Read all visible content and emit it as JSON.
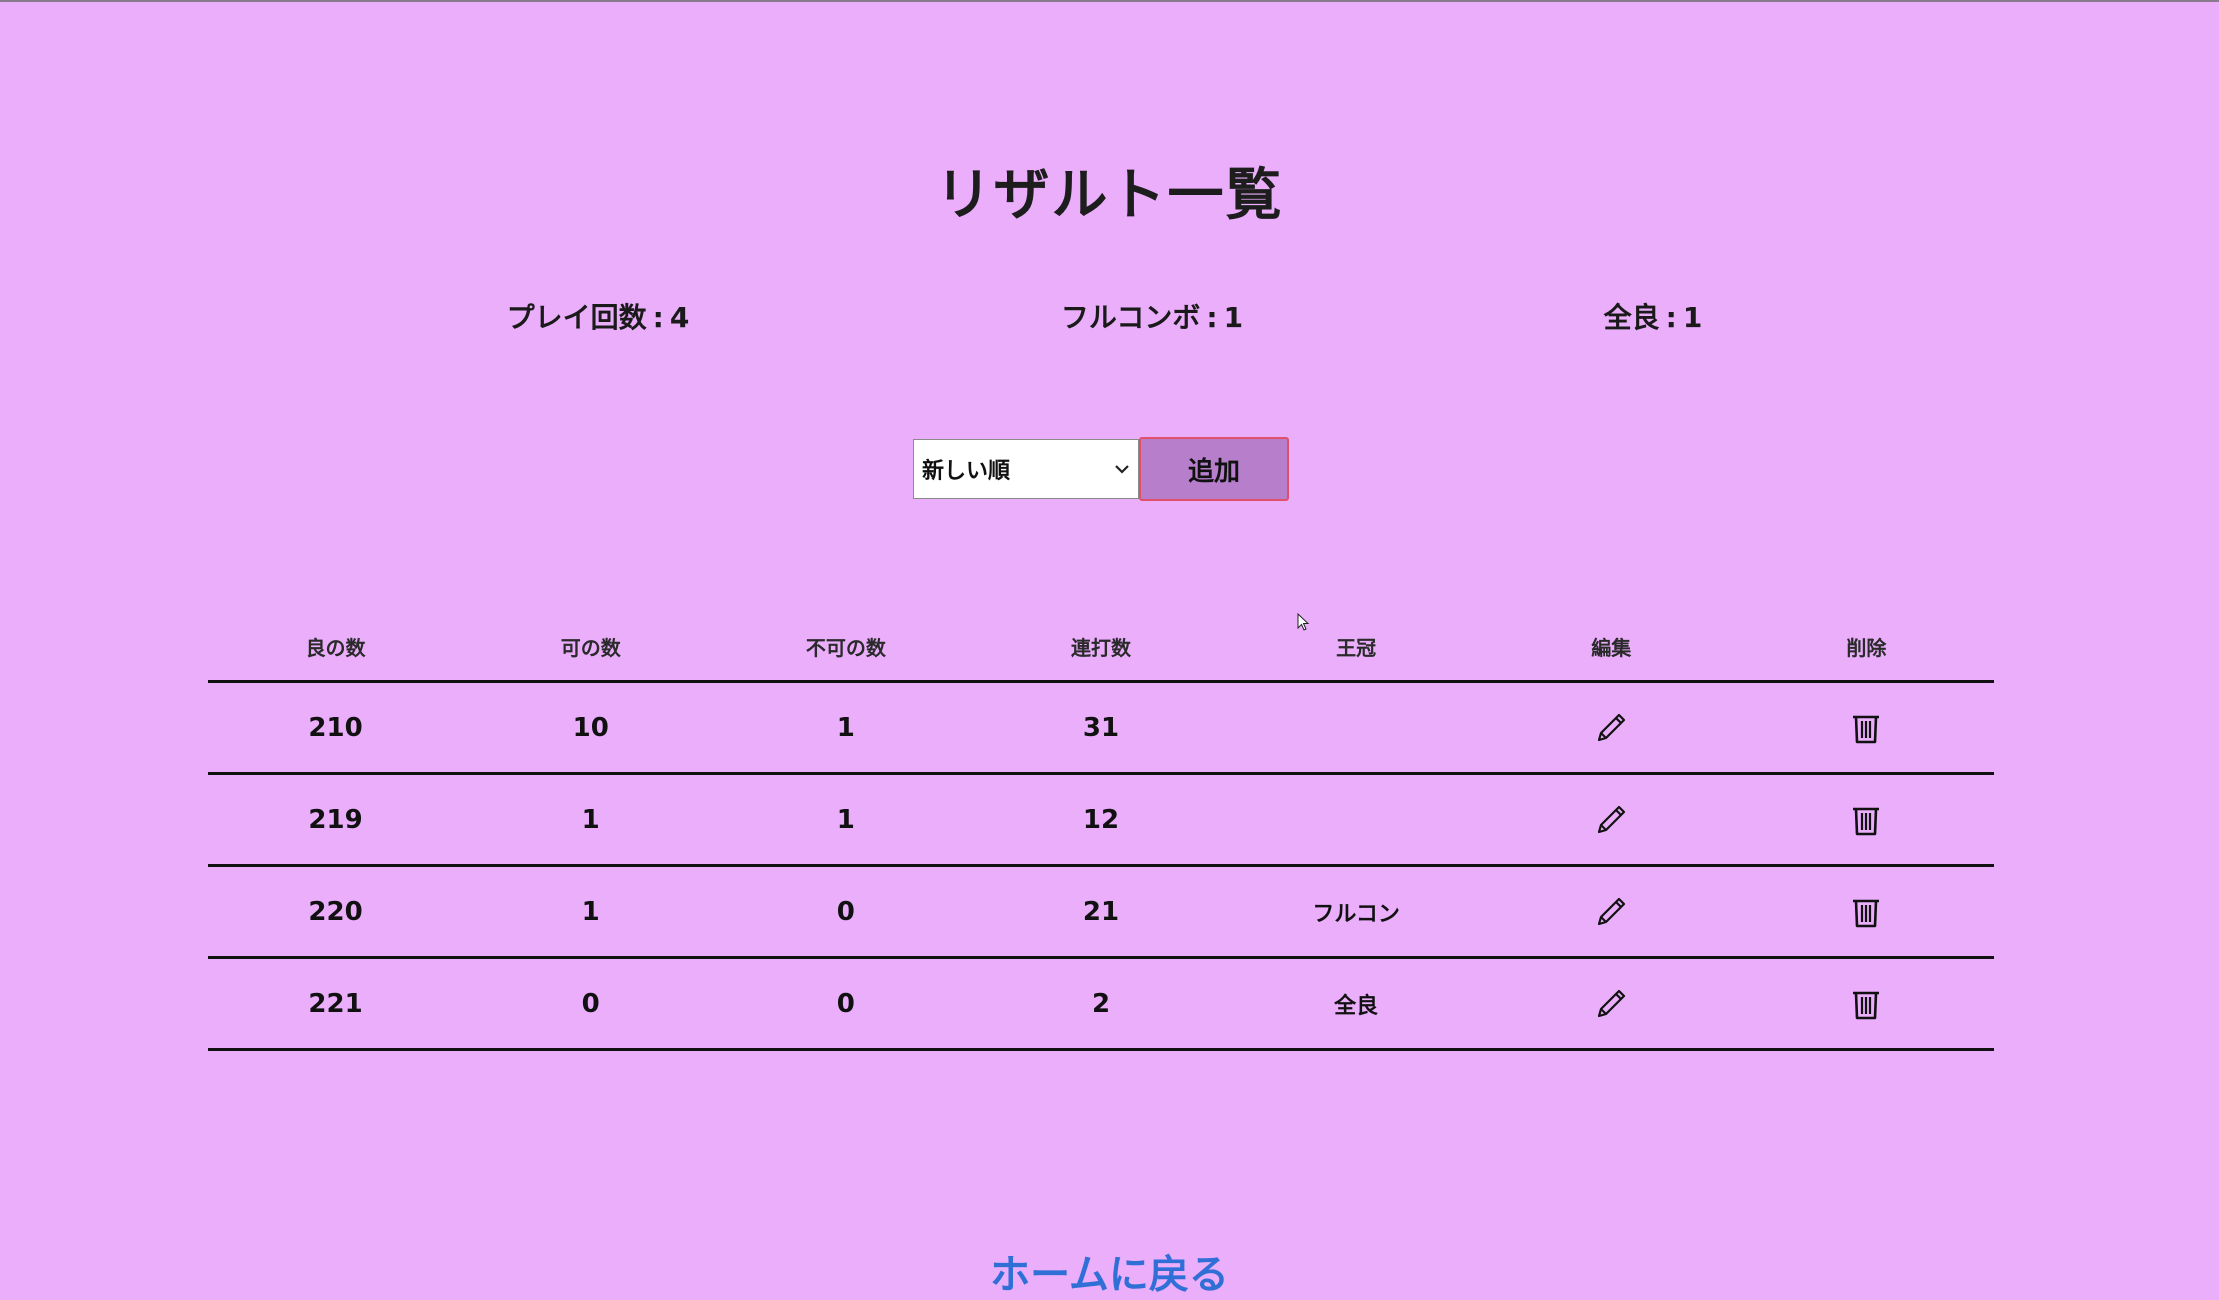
{
  "page": {
    "title": "リザルト一覧"
  },
  "stats": {
    "plays_label": "プレイ回数",
    "plays_value": "4",
    "full_combo_label": "フルコンボ",
    "full_combo_value": "1",
    "all_good_label": "全良",
    "all_good_value": "1",
    "separator": ":"
  },
  "controls": {
    "sort_selected": "新しい順",
    "add_label": "追加"
  },
  "table": {
    "headers": [
      "良の数",
      "可の数",
      "不可の数",
      "連打数",
      "王冠",
      "編集",
      "削除"
    ],
    "rows": [
      {
        "good": "210",
        "ok": "10",
        "bad": "1",
        "rolls": "31",
        "crown": ""
      },
      {
        "good": "219",
        "ok": "1",
        "bad": "1",
        "rolls": "12",
        "crown": ""
      },
      {
        "good": "220",
        "ok": "1",
        "bad": "0",
        "rolls": "21",
        "crown": "フルコン"
      },
      {
        "good": "221",
        "ok": "0",
        "bad": "0",
        "rolls": "2",
        "crown": "全良"
      }
    ]
  },
  "footer": {
    "link_text": "ホームに戻る"
  },
  "icons": {
    "edit": "pencil-icon",
    "delete": "trash-icon",
    "sort": "chevron-down-icon",
    "cursor": "cursor-icon"
  },
  "colors": {
    "background": "#eaaefb",
    "add_button": "#b77ecb",
    "add_button_border": "#e0506a",
    "link": "#2f6fd6"
  }
}
